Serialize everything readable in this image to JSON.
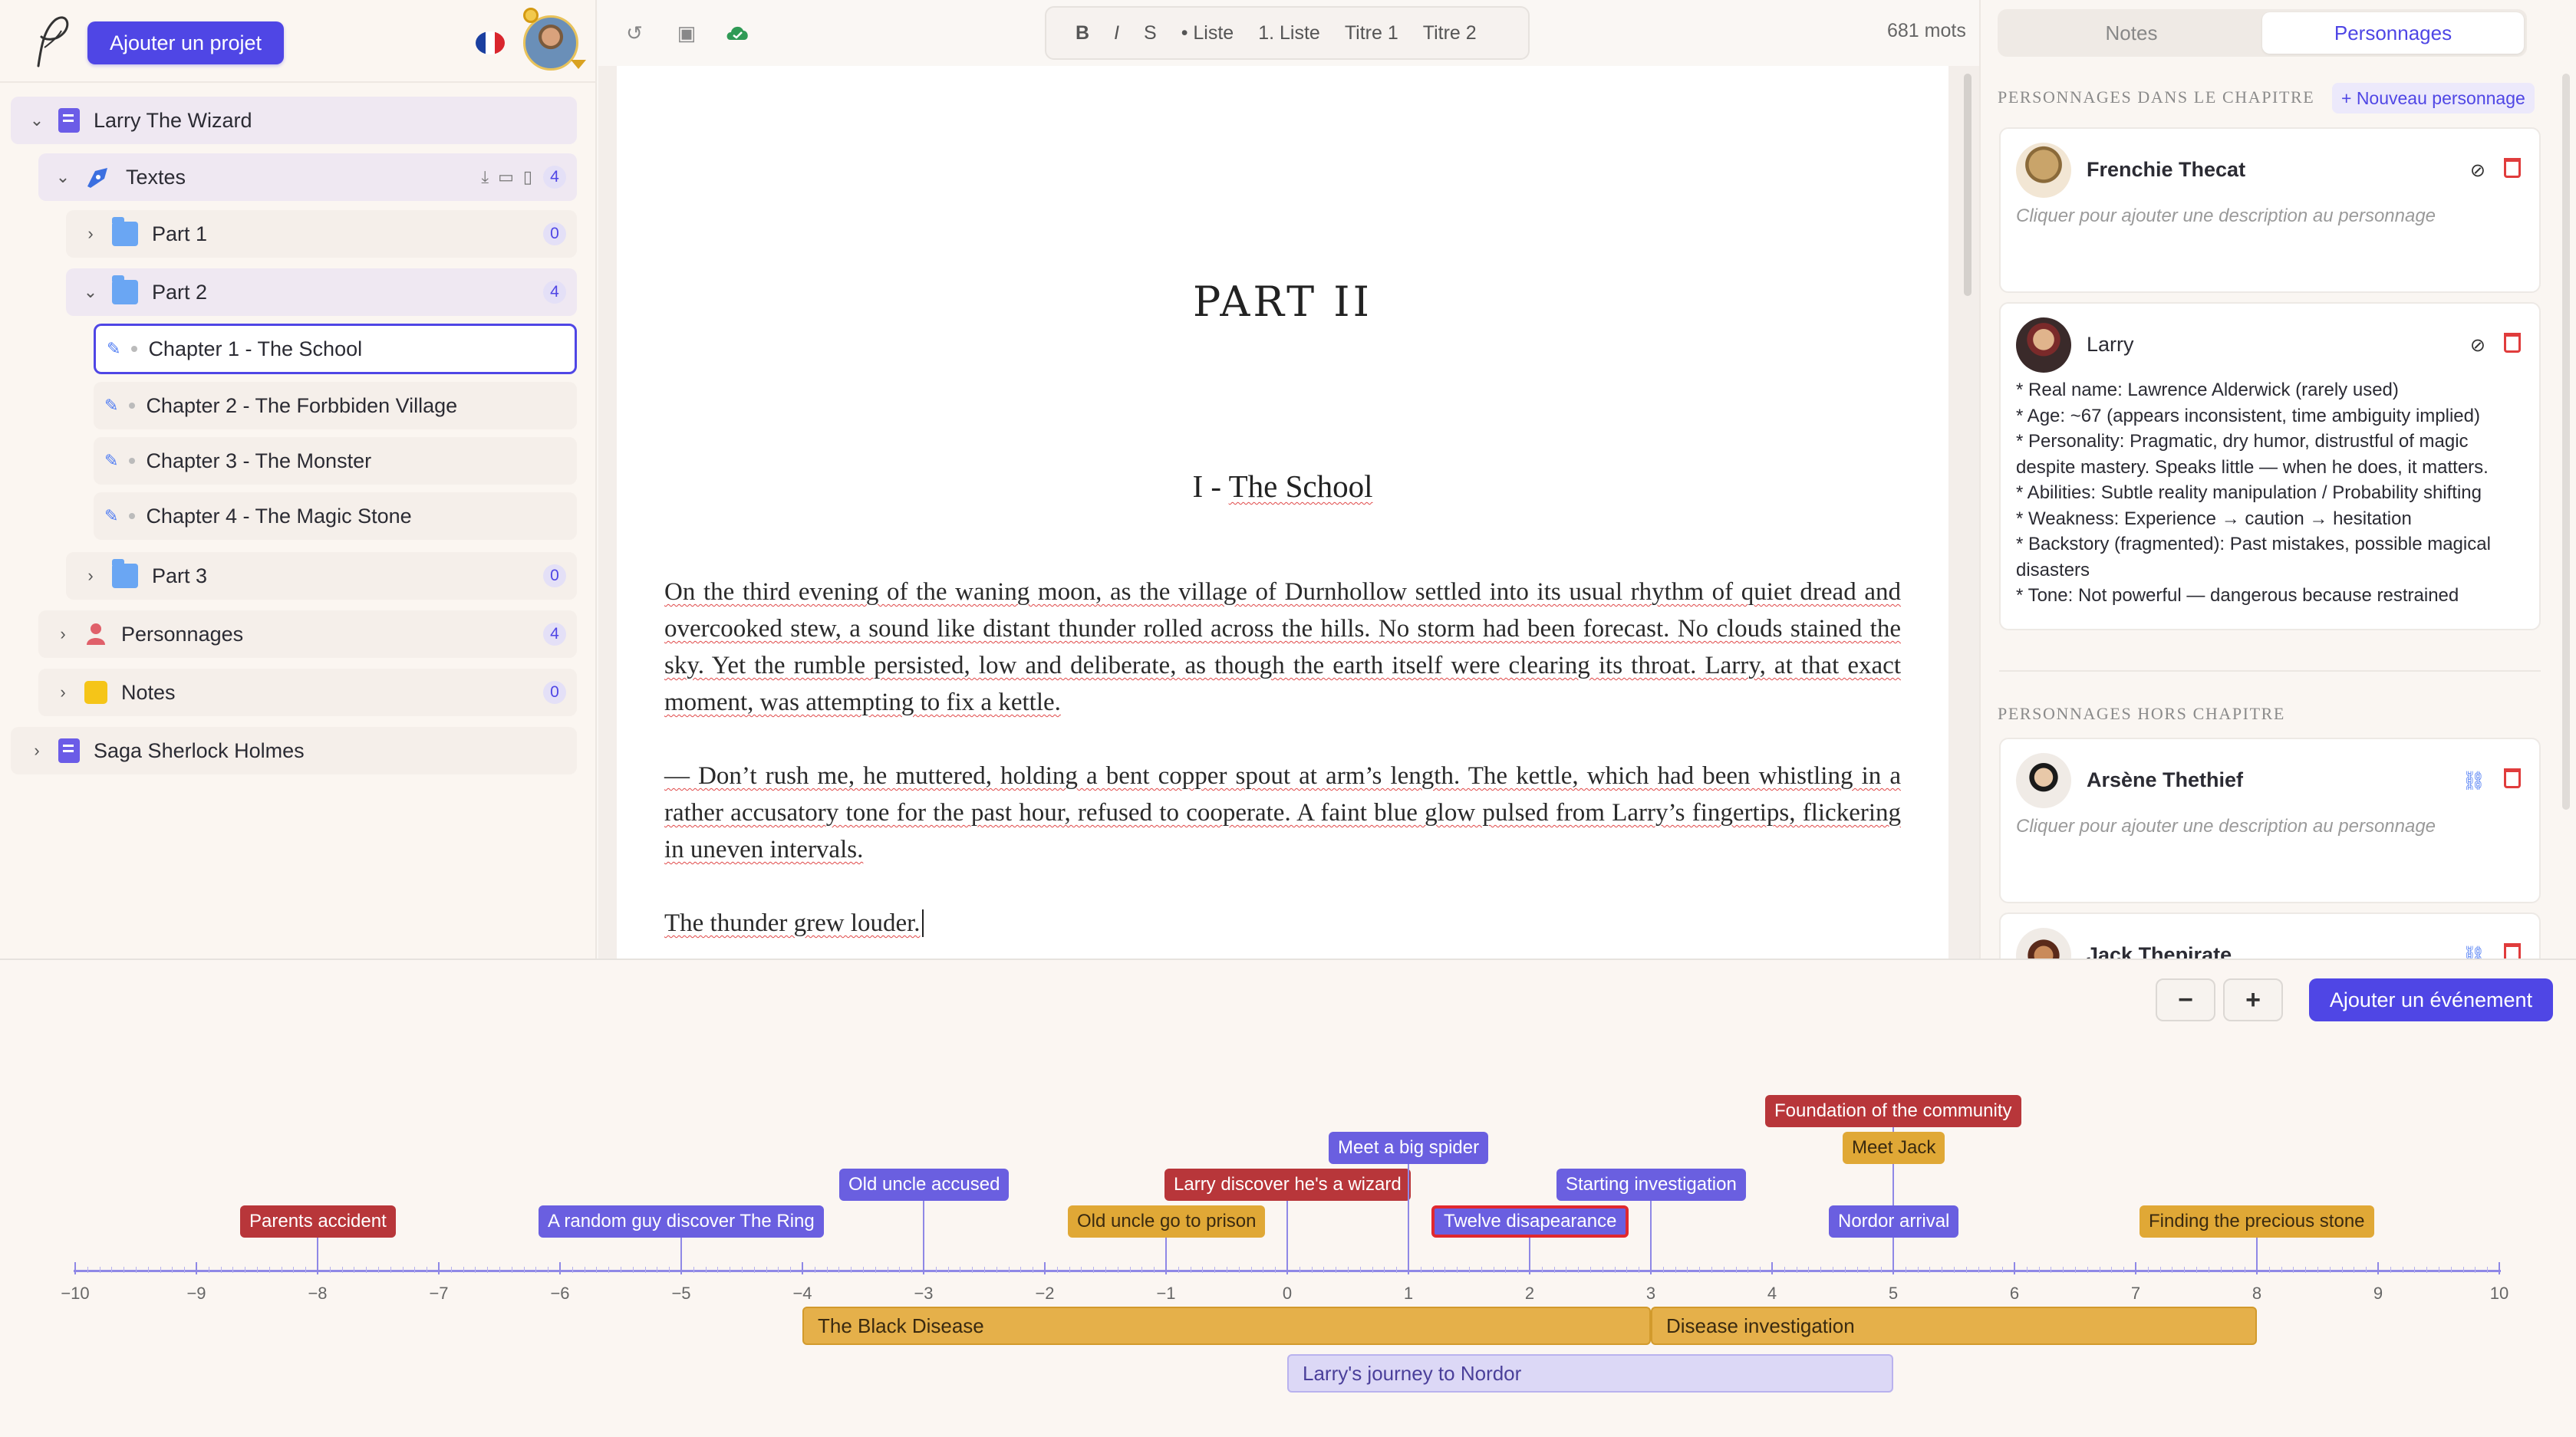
{
  "sidebar": {
    "add_project": "Ajouter un projet",
    "tree": {
      "project1": "Larry The Wizard",
      "texts": {
        "label": "Textes",
        "count": "4"
      },
      "part1": {
        "label": "Part 1",
        "count": "0"
      },
      "part2": {
        "label": "Part 2",
        "count": "4"
      },
      "chapters": [
        "Chapter 1 - The School",
        "Chapter 2 - The Forbbiden Village",
        "Chapter 3 - The Monster",
        "Chapter 4 - The Magic Stone"
      ],
      "part3": {
        "label": "Part 3",
        "count": "0"
      },
      "characters": {
        "label": "Personnages",
        "count": "4"
      },
      "notes": {
        "label": "Notes",
        "count": "0"
      },
      "project2": "Saga Sherlock Holmes"
    }
  },
  "toolbar": {
    "bold": "B",
    "italic": "I",
    "strike": "S",
    "bullet_list": "• Liste",
    "numbered_list": "1. Liste",
    "h1": "Titre 1",
    "h2": "Titre 2",
    "word_count": "681 mots"
  },
  "editor": {
    "part_title": "PART II",
    "chapter_title_prefix": "I - ",
    "chapter_title_name": "The School",
    "p1": "On the third evening of the waning moon, as the village of Durnhollow settled into its usual rhythm of quiet dread and overcooked stew, a sound like distant thunder rolled across the hills. No storm had been forecast. No clouds stained the sky. Yet the rumble persisted, low and deliberate, as though the earth itself were clearing its throat. Larry, at that exact moment, was attempting to fix a kettle.",
    "p2": "— Don’t rush me, he muttered, holding a bent copper spout at arm’s length. The kettle, which had been whistling in a rather accusatory tone for the past hour, refused to cooperate. A faint blue glow pulsed from Larry’s fingertips, flickering in uneven intervals.",
    "p3": "The thunder grew louder."
  },
  "right_panel": {
    "tabs": [
      "Notes",
      "Personnages"
    ],
    "active_tab": "Personnages",
    "in_chapter_header": "Personnages dans le chapitre",
    "new_character": "+ Nouveau personnage",
    "out_chapter_header": "Personnages hors chapitre",
    "empty_desc": "Cliquer pour ajouter une description au personnage",
    "characters_in": [
      {
        "name": "Frenchie Thecat"
      },
      {
        "name": "Larry",
        "details": [
          "* Real name: Lawrence Alderwick (rarely used)",
          "* Age: ~67 (appears inconsistent, time ambiguity implied)",
          "* Personality: Pragmatic, dry humor, distrustful of magic",
          "despite mastery. Speaks little — when he does, it matters.",
          "* Abilities: Subtle reality manipulation / Probability shifting",
          "* Weakness: Experience → caution → hesitation",
          "* Backstory (fragmented): Past mistakes, possible magical",
          "disasters",
          "* Tone: Not powerful — dangerous because restrained"
        ]
      }
    ],
    "characters_out": [
      {
        "name": "Arsène Thethief"
      },
      {
        "name": "Jack Thepirate"
      }
    ]
  },
  "timeline": {
    "add_event": "Ajouter un événement",
    "zoom_out": "−",
    "zoom_in": "+",
    "axis": {
      "min": -10,
      "max": 10
    },
    "events": [
      {
        "label": "Parents accident",
        "x": -8,
        "row": 0,
        "color": "red"
      },
      {
        "label": "A random guy discover The Ring",
        "x": -5,
        "row": 0,
        "color": "blue"
      },
      {
        "label": "Old uncle accused",
        "x": -3,
        "row": 1,
        "color": "blue"
      },
      {
        "label": "Old uncle go to prison",
        "x": -1,
        "row": 0,
        "color": "gold"
      },
      {
        "label": "Larry discover he's a wizard",
        "x": 0,
        "row": 1,
        "color": "red"
      },
      {
        "label": "Meet a big spider",
        "x": 1,
        "row": 2,
        "color": "blue"
      },
      {
        "label": "Twelve disapearance",
        "x": 2,
        "row": 0,
        "color": "sel"
      },
      {
        "label": "Starting investigation",
        "x": 3,
        "row": 1,
        "color": "blue"
      },
      {
        "label": "Foundation of the community",
        "x": 5,
        "row": 3,
        "color": "red"
      },
      {
        "label": "Meet Jack",
        "x": 5,
        "row": 2,
        "color": "gold"
      },
      {
        "label": "Nordor arrival",
        "x": 5,
        "row": 0,
        "color": "blue"
      },
      {
        "label": "Finding the precious stone",
        "x": 8,
        "row": 0,
        "color": "gold"
      }
    ],
    "periods": [
      {
        "label": "The Black Disease",
        "start": -4,
        "end": 3,
        "lane": 0,
        "color": "gold"
      },
      {
        "label": "Disease investigation",
        "start": 3,
        "end": 8,
        "lane": 0,
        "color": "gold"
      },
      {
        "label": "Larry's journey to Nordor",
        "start": 0,
        "end": 5,
        "lane": 1,
        "color": "lav"
      }
    ]
  }
}
